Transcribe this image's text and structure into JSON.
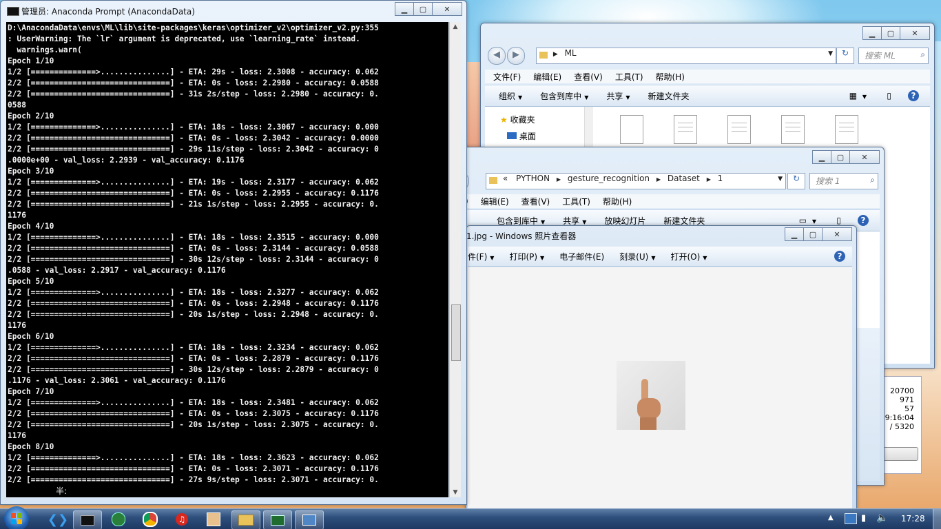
{
  "console": {
    "title": "管理员: Anaconda Prompt (AnacondaData)",
    "ime_status": "半:",
    "lines": [
      "D:\\AnacondaData\\envs\\ML\\lib\\site-packages\\keras\\optimizer_v2\\optimizer_v2.py:355",
      ": UserWarning: The `lr` argument is deprecated, use `learning_rate` instead.",
      "  warnings.warn(",
      "Epoch 1/10",
      "1/2 [==============>...............] - ETA: 29s - loss: 2.3008 - accuracy: 0.062",
      "2/2 [==============================] - ETA: 0s - loss: 2.2980 - accuracy: 0.0588",
      "2/2 [==============================] - 31s 2s/step - loss: 2.2980 - accuracy: 0.",
      "0588",
      "Epoch 2/10",
      "1/2 [==============>...............] - ETA: 18s - loss: 2.3067 - accuracy: 0.000",
      "2/2 [==============================] - ETA: 0s - loss: 2.3042 - accuracy: 0.0000",
      "2/2 [==============================] - 29s 11s/step - loss: 2.3042 - accuracy: 0",
      ".0000e+00 - val_loss: 2.2939 - val_accuracy: 0.1176",
      "Epoch 3/10",
      "1/2 [==============>...............] - ETA: 19s - loss: 2.3177 - accuracy: 0.062",
      "2/2 [==============================] - ETA: 0s - loss: 2.2955 - accuracy: 0.1176",
      "2/2 [==============================] - 21s 1s/step - loss: 2.2955 - accuracy: 0.",
      "1176",
      "Epoch 4/10",
      "1/2 [==============>...............] - ETA: 18s - loss: 2.3515 - accuracy: 0.000",
      "2/2 [==============================] - ETA: 0s - loss: 2.3144 - accuracy: 0.0588",
      "2/2 [==============================] - 30s 12s/step - loss: 2.3144 - accuracy: 0",
      ".0588 - val_loss: 2.2917 - val_accuracy: 0.1176",
      "Epoch 5/10",
      "1/2 [==============>...............] - ETA: 18s - loss: 2.3277 - accuracy: 0.062",
      "2/2 [==============================] - ETA: 0s - loss: 2.2948 - accuracy: 0.1176",
      "2/2 [==============================] - 20s 1s/step - loss: 2.2948 - accuracy: 0.",
      "1176",
      "Epoch 6/10",
      "1/2 [==============>...............] - ETA: 18s - loss: 2.3234 - accuracy: 0.062",
      "2/2 [==============================] - ETA: 0s - loss: 2.2879 - accuracy: 0.1176",
      "2/2 [==============================] - 30s 12s/step - loss: 2.2879 - accuracy: 0",
      ".1176 - val_loss: 2.3061 - val_accuracy: 0.1176",
      "Epoch 7/10",
      "1/2 [==============>...............] - ETA: 18s - loss: 2.3481 - accuracy: 0.062",
      "2/2 [==============================] - ETA: 0s - loss: 2.3075 - accuracy: 0.1176",
      "2/2 [==============================] - 20s 1s/step - loss: 2.3075 - accuracy: 0.",
      "1176",
      "Epoch 8/10",
      "1/2 [==============>...............] - ETA: 18s - loss: 2.3623 - accuracy: 0.062",
      "2/2 [==============================] - ETA: 0s - loss: 2.3071 - accuracy: 0.1176",
      "2/2 [==============================] - 27s 9s/step - loss: 2.3071 - accuracy: 0."
    ]
  },
  "explorer_ml": {
    "address": "ML",
    "search_placeholder": "搜索 ML",
    "menu": [
      "文件(F)",
      "编辑(E)",
      "查看(V)",
      "工具(T)",
      "帮助(H)"
    ],
    "commands": [
      "组织",
      "包含到库中",
      "共享",
      "新建文件夹"
    ],
    "nav": {
      "favorites": "收藏夹",
      "desktop": "桌面"
    },
    "right_numbers": [
      "20700",
      "971",
      "57",
      "9:16:04",
      "/ 5320"
    ]
  },
  "explorer_dataset": {
    "breadcrumb": [
      "«",
      "PYTHON",
      "gesture_recognition",
      "Dataset",
      "1"
    ],
    "search_placeholder": "搜索 1",
    "menu": [
      ")",
      "编辑(E)",
      "查看(V)",
      "工具(T)",
      "帮助(H)"
    ],
    "commands": [
      "包含到库中",
      "共享",
      "放映幻灯片",
      "新建文件夹"
    ]
  },
  "viewer": {
    "title": "1.jpg - Windows 照片查看器",
    "menu": [
      "件(F)",
      "打印(P)",
      "电子邮件(E)",
      "刻录(U)",
      "打开(O)"
    ]
  },
  "taskbar": {
    "time": "17:28"
  },
  "colors": {
    "console_bg": "#000000",
    "console_fg": "#f2f2f2",
    "taskbar": "#1d3862"
  }
}
